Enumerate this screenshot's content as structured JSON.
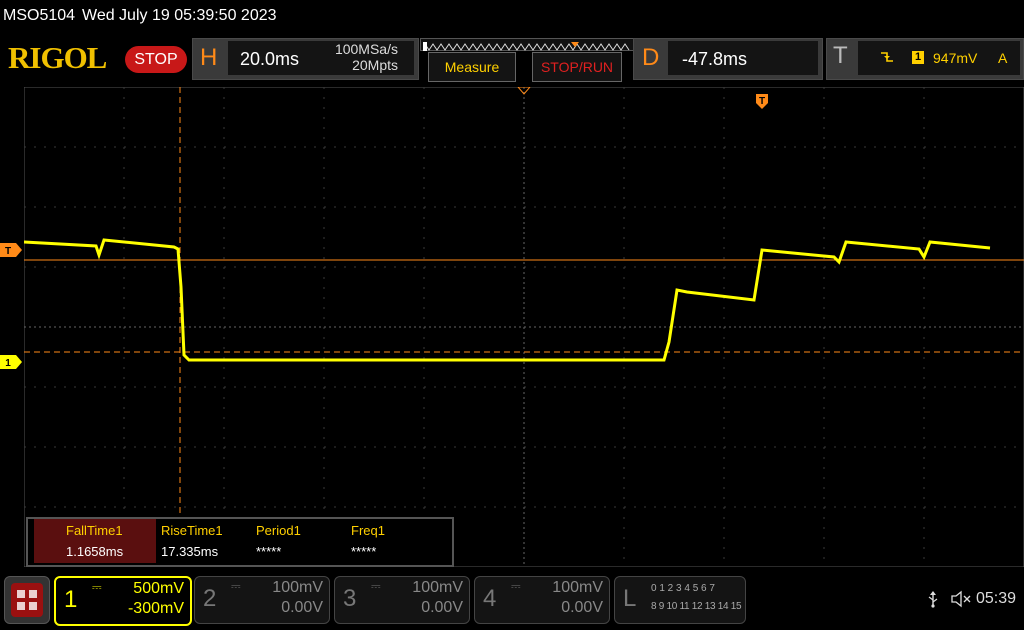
{
  "header": {
    "model": "MSO5104",
    "datetime": "Wed July 19 05:39:50 2023",
    "logo": "RIGOL",
    "status": "STOP"
  },
  "horizontal": {
    "letter": "H",
    "timebase": "20.0ms",
    "sample_rate": "100MSa/s",
    "memory_depth": "20Mpts"
  },
  "buttons": {
    "measure": "Measure",
    "stop_run": "STOP/RUN"
  },
  "delay": {
    "letter": "D",
    "value": "-47.8ms"
  },
  "trigger": {
    "letter": "T",
    "source": "1",
    "level": "947mV",
    "mode": "A",
    "marker": "T"
  },
  "channel_markers": {
    "ch1": "1",
    "trig": "T"
  },
  "measurements": {
    "headers": [
      "FallTime1",
      "RiseTime1",
      "Period1",
      "Freq1"
    ],
    "values": [
      "1.1658ms",
      "17.335ms",
      "*****",
      "*****"
    ]
  },
  "channels": [
    {
      "num": "1",
      "scale": "500mV",
      "offset": "-300mV",
      "active": true
    },
    {
      "num": "2",
      "scale": "100mV",
      "offset": "0.00V",
      "active": false
    },
    {
      "num": "3",
      "scale": "100mV",
      "offset": "0.00V",
      "active": false
    },
    {
      "num": "4",
      "scale": "100mV",
      "offset": "0.00V",
      "active": false
    }
  ],
  "logic": {
    "letter": "L",
    "row1": "0 1 2 3  4 5 6 7",
    "row2": "8 9 10 11 12 13 14 15"
  },
  "system": {
    "clock": "05:39",
    "usb_icon": "usb-icon",
    "sound_icon": "speaker-muted-icon"
  },
  "colors": {
    "ch1": "#ffff00",
    "trigger": "#ff8a18",
    "stop": "#c81818"
  }
}
